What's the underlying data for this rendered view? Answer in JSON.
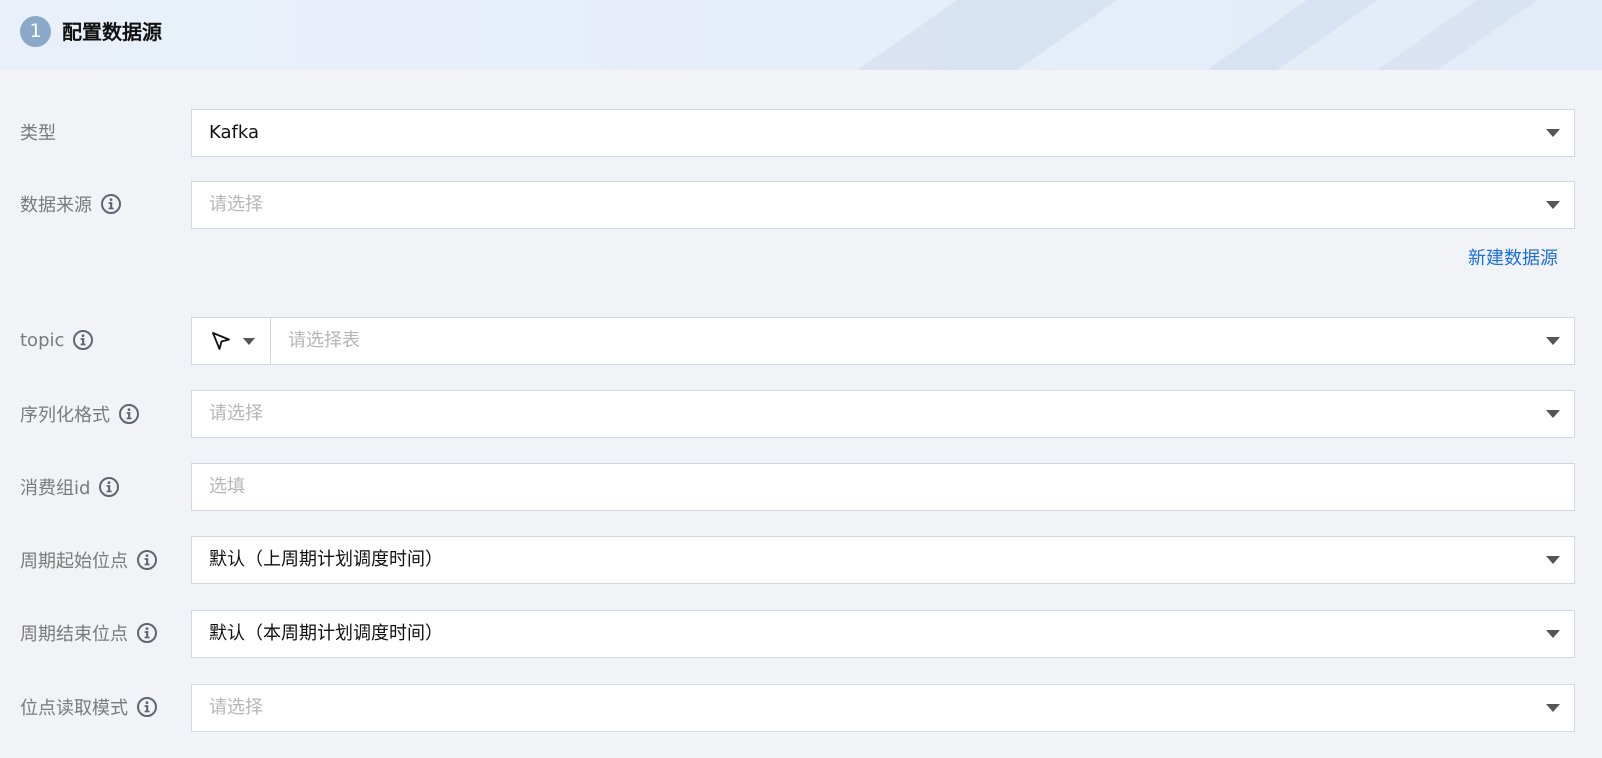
{
  "section": {
    "step": "1",
    "title": "配置数据源"
  },
  "form": {
    "type": {
      "label": "类型",
      "value": "Kafka"
    },
    "data_source": {
      "label": "数据来源",
      "placeholder": "请选择",
      "new_link": "新建数据源"
    },
    "topic": {
      "label": "topic",
      "placeholder": "请选择表"
    },
    "serialization": {
      "label": "序列化格式",
      "placeholder": "请选择"
    },
    "consumer_group": {
      "label": "消费组id",
      "placeholder": "选填"
    },
    "cycle_start": {
      "label": "周期起始位点",
      "value": "默认（上周期计划调度时间）"
    },
    "cycle_end": {
      "label": "周期结束位点",
      "value": "默认（本周期计划调度时间）"
    },
    "offset_mode": {
      "label": "位点读取模式",
      "placeholder": "请选择"
    }
  },
  "colors": {
    "link": "#1b6fe0",
    "badge": "#8aa8c7",
    "label": "#7a7a7a"
  }
}
